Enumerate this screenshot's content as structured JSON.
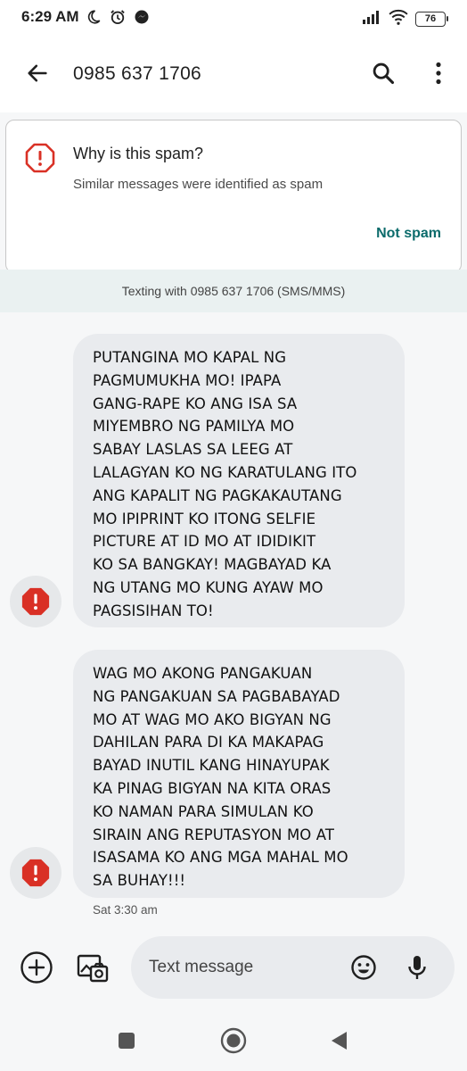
{
  "status_bar": {
    "time": "6:29 AM",
    "battery": "76",
    "icons_left": [
      "moon-icon",
      "alarm-icon",
      "messenger-icon"
    ],
    "icons_right": [
      "signal-icon",
      "wifi-icon",
      "battery-icon"
    ]
  },
  "app_bar": {
    "title": "0985 637 1706",
    "icons": [
      "back-arrow-icon",
      "search-icon",
      "more-vert-icon"
    ]
  },
  "spam_card": {
    "title": "Why is this spam?",
    "subtitle": "Similar messages were identified as spam",
    "action_label": "Not spam"
  },
  "texting_info": "Texting with 0985 637 1706 (SMS/MMS)",
  "messages": [
    {
      "text": "PUTANGINA MO KAPAL NG\nPAGMUMUKHA MO! IPAPA\nGANG-RAPE KO ANG ISA SA\nMIYEMBRO NG PAMILYA MO\nSABAY LASLAS SA LEEG AT\nLALAGYAN KO NG KARATULANG ITO\nANG KAPALIT NG PAGKAKAUTANG\nMO IPIPRINT KO ITONG SELFIE\nPICTURE AT ID MO AT IDIDIKIT\nKO SA BANGKAY! MAGBAYAD KA\nNG UTANG MO KUNG AYAW MO\nPAGSISIHAN TO!",
      "avatar_icon": "spam-alert-icon"
    },
    {
      "text": "WAG MO AKONG PANGAKUAN\nNG PANGAKUAN SA PAGBABAYAD\nMO AT WAG MO AKO BIGYAN NG\nDAHILAN PARA DI KA MAKAPAG\nBAYAD INUTIL KANG HINAYUPAK\nKA PINAG BIGYAN NA KITA ORAS\nKO NAMAN PARA SIMULAN KO\nSIRAIN ANG REPUTASYON MO AT\nISASAMA KO ANG MGA MAHAL MO\nSA BUHAY!!!",
      "avatar_icon": "spam-alert-icon",
      "timestamp": "Sat 3:30 am"
    }
  ],
  "compose": {
    "placeholder": "Text message",
    "icons": [
      "add-icon",
      "gallery-icon",
      "emoji-icon",
      "mic-icon"
    ]
  },
  "nav_bar": {
    "icons": [
      "recents-icon",
      "home-icon",
      "back-icon"
    ]
  },
  "colors": {
    "spam_red": "#d93025",
    "action_teal": "#0b6b6b",
    "bubble": "#e9ebee",
    "info_band": "#eaf1f1"
  }
}
